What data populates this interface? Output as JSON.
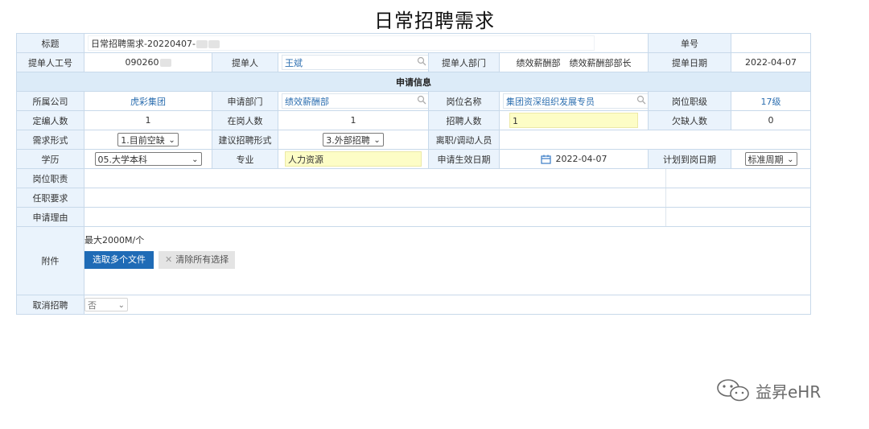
{
  "page_title": "日常招聘需求",
  "row1": {
    "title_label": "标题",
    "title_value": "日常招聘需求-20220407-",
    "order_no_label": "单号",
    "order_no_value": ""
  },
  "row2": {
    "emp_id_label": "提单人工号",
    "emp_id_value": "090260",
    "submitter_label": "提单人",
    "submitter_value": "王斌",
    "dept_label": "提单人部门",
    "dept_value": "绩效薪酬部　绩效薪酬部部长",
    "date_label": "提单日期",
    "date_value": "2022-04-07"
  },
  "section": "申请信息",
  "row3": {
    "company_label": "所属公司",
    "company_value": "虎彩集团",
    "apply_dept_label": "申请部门",
    "apply_dept_value": "绩效薪酬部",
    "position_label": "岗位名称",
    "position_value": "集团资深组织发展专员",
    "level_label": "岗位职级",
    "level_value": "17级"
  },
  "row4": {
    "quota_label": "定编人数",
    "quota_value": "1",
    "onjob_label": "在岗人数",
    "onjob_value": "1",
    "hire_label": "招聘人数",
    "hire_value": "1",
    "short_label": "欠缺人数",
    "short_value": "0"
  },
  "row5": {
    "demand_label": "需求形式",
    "demand_value": "1.目前空缺",
    "recruit_form_label": "建议招聘形式",
    "recruit_form_value": "3.外部招聘",
    "leaver_label": "离职/调动人员",
    "leaver_value": ""
  },
  "row6": {
    "edu_label": "学历",
    "edu_value": "05.大学本科",
    "major_label": "专业",
    "major_value": "人力资源",
    "effective_label": "申请生效日期",
    "effective_value": "2022-04-07",
    "plan_label": "计划到岗日期",
    "plan_value": "标准周期"
  },
  "duty_label": "岗位职责",
  "req_label": "任职要求",
  "reason_label": "申请理由",
  "attach": {
    "label": "附件",
    "limit": "最大2000M/个",
    "select_btn": "选取多个文件",
    "clear_btn": "清除所有选择"
  },
  "cancel": {
    "label": "取消招聘",
    "value": "否"
  },
  "watermark": "益昇eHR",
  "colors": {
    "accent": "#1f6bb6",
    "label_bg": "#eaf3fc",
    "highlight": "#fdfdc6",
    "border": "#c8d9ea"
  }
}
